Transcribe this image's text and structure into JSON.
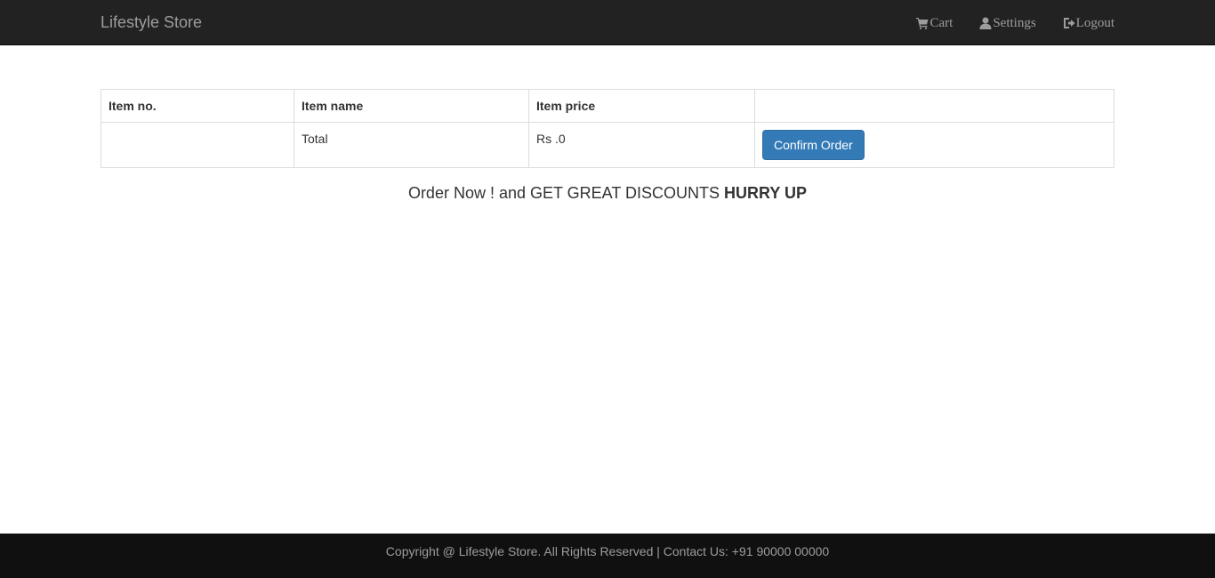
{
  "navbar": {
    "brand": "Lifestyle Store",
    "links": [
      {
        "label": "Cart",
        "icon": "shopping-cart-icon"
      },
      {
        "label": "Settings",
        "icon": "user-icon"
      },
      {
        "label": "Logout",
        "icon": "logout-icon"
      }
    ]
  },
  "table": {
    "headers": [
      "Item no.",
      "Item name",
      "Item price",
      ""
    ],
    "rows": [
      {
        "item_no": "",
        "item_name": "Total",
        "item_price": "Rs .0",
        "action": "Confirm Order"
      }
    ]
  },
  "promo": {
    "text": "Order Now ! and GET GREAT DISCOUNTS",
    "emphasis": "HURRY UP"
  },
  "footer": {
    "text": "Copyright @ Lifestyle Store. All Rights Reserved | Contact Us: +91 90000 00000"
  },
  "colors": {
    "navbar_bg": "#222222",
    "footer_bg": "#101010",
    "primary_button": "#337ab7",
    "nav_text": "#9d9d9d"
  }
}
